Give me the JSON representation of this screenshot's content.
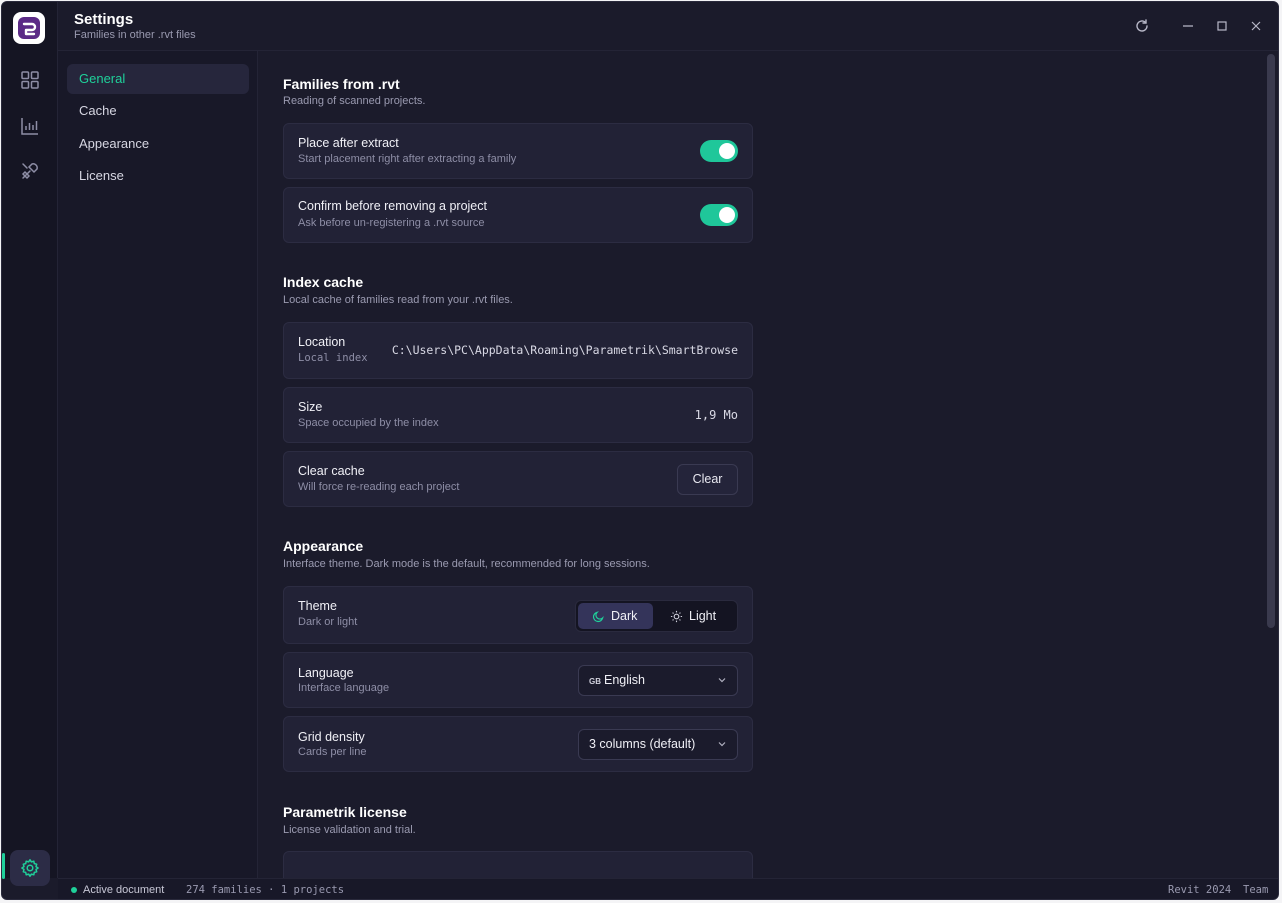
{
  "app": {
    "title": "Settings",
    "subtitle": "Families in other .rvt files"
  },
  "rail": {
    "items": [
      "grid-icon",
      "chart-icon",
      "tools-icon",
      "gear-icon"
    ]
  },
  "nav": {
    "items": [
      {
        "label": "General"
      },
      {
        "label": "Cache"
      },
      {
        "label": "Appearance"
      },
      {
        "label": "License"
      }
    ]
  },
  "sections": {
    "families": {
      "title": "Families from .rvt",
      "desc": "Reading of scanned projects.",
      "place": {
        "label": "Place after extract",
        "sub": "Start placement right after extracting a family",
        "enabled": true
      },
      "confirm": {
        "label": "Confirm before removing a project",
        "sub": "Ask before un-registering a .rvt source",
        "enabled": true
      }
    },
    "cache": {
      "title": "Index cache",
      "desc": "Local cache of families read from your .rvt files.",
      "location": {
        "label": "Location",
        "sub": "Local index",
        "value": "C:\\Users\\PC\\AppData\\Roaming\\Parametrik\\SmartBrowse"
      },
      "size": {
        "label": "Size",
        "sub": "Space occupied by the index",
        "value": "1,9 Mo"
      },
      "clear": {
        "label": "Clear cache",
        "sub": "Will force re-reading each project",
        "button": "Clear"
      }
    },
    "appearance": {
      "title": "Appearance",
      "desc": "Interface theme. Dark mode is the default, recommended for long sessions.",
      "theme": {
        "label": "Theme",
        "sub": "Dark or light",
        "dark": "Dark",
        "light": "Light",
        "selected": "Dark"
      },
      "language": {
        "label": "Language",
        "sub": "Interface language",
        "flag": "GB",
        "value": "English"
      },
      "density": {
        "label": "Grid density",
        "sub": "Cards per line",
        "value": "3 columns (default)"
      }
    },
    "license": {
      "title": "Parametrik license",
      "desc": "License validation and trial."
    }
  },
  "status": {
    "active": "Active document",
    "counts": "274 families · 1 projects",
    "revit": "Revit 2024",
    "team": "Team"
  },
  "colors": {
    "accent": "#1fd09a",
    "background": "#1b1b2b",
    "card": "#222236"
  }
}
